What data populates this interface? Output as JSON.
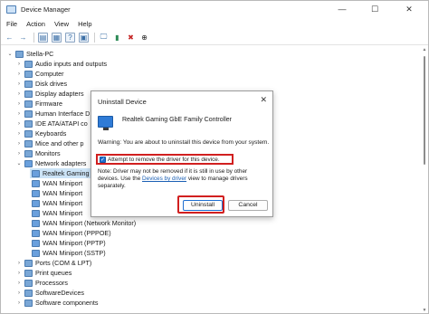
{
  "window": {
    "title": "Device Manager",
    "minimize": "—",
    "maximize": "☐",
    "close": "✕"
  },
  "menu": [
    "File",
    "Action",
    "View",
    "Help"
  ],
  "toolbar": {
    "icons": [
      "back-arrow-icon",
      "forward-arrow-icon",
      "properties-icon",
      "document-icon",
      "help-icon",
      "view-icon",
      "monitor-icon",
      "update-driver-icon",
      "uninstall-red-x-icon",
      "download-icon"
    ]
  },
  "tree": {
    "root": "Stella-PC",
    "items": [
      {
        "label": "Audio inputs and outputs",
        "chev": "›"
      },
      {
        "label": "Computer",
        "chev": "›"
      },
      {
        "label": "Disk drives",
        "chev": "›"
      },
      {
        "label": "Display adapters",
        "chev": "›"
      },
      {
        "label": "Firmware",
        "chev": "›"
      },
      {
        "label": "Human Interface D",
        "chev": "›"
      },
      {
        "label": "IDE ATA/ATAPI co",
        "chev": "›"
      },
      {
        "label": "Keyboards",
        "chev": "›"
      },
      {
        "label": "Mice and other p",
        "chev": "›"
      },
      {
        "label": "Monitors",
        "chev": "›"
      },
      {
        "label": "Network adapters",
        "chev": "⌄"
      }
    ],
    "network_children": [
      "Realtek Gaming",
      "WAN Miniport",
      "WAN Miniport",
      "WAN Miniport",
      "WAN Miniport",
      "WAN Miniport (Network Monitor)",
      "WAN Miniport (PPPOE)",
      "WAN Miniport (PPTP)",
      "WAN Miniport (SSTP)"
    ],
    "after": [
      {
        "label": "Ports (COM & LPT)",
        "chev": "›"
      },
      {
        "label": "Print queues",
        "chev": "›"
      },
      {
        "label": "Processors",
        "chev": "›"
      },
      {
        "label": "SoftwareDevices",
        "chev": "›"
      },
      {
        "label": "Software components",
        "chev": "›"
      }
    ]
  },
  "dialog": {
    "title": "Uninstall Device",
    "close": "✕",
    "device_name": "Realtek Gaming GbE Family Controller",
    "warning": "Warning: You are about to uninstall this device from your system.",
    "checkbox_label": "Attempt to remove the driver for this device.",
    "checkbox_checked": "✓",
    "note_before": "Note: Driver may not be removed if it is still in use by other devices. Use the ",
    "note_link": "Devices by driver",
    "note_after": " view to manage drivers separately.",
    "uninstall_button": "Uninstall",
    "cancel_button": "Cancel"
  },
  "colors": {
    "highlight": "#d11f1f",
    "accent": "#1f6fd0",
    "selection": "#cce4f7"
  }
}
